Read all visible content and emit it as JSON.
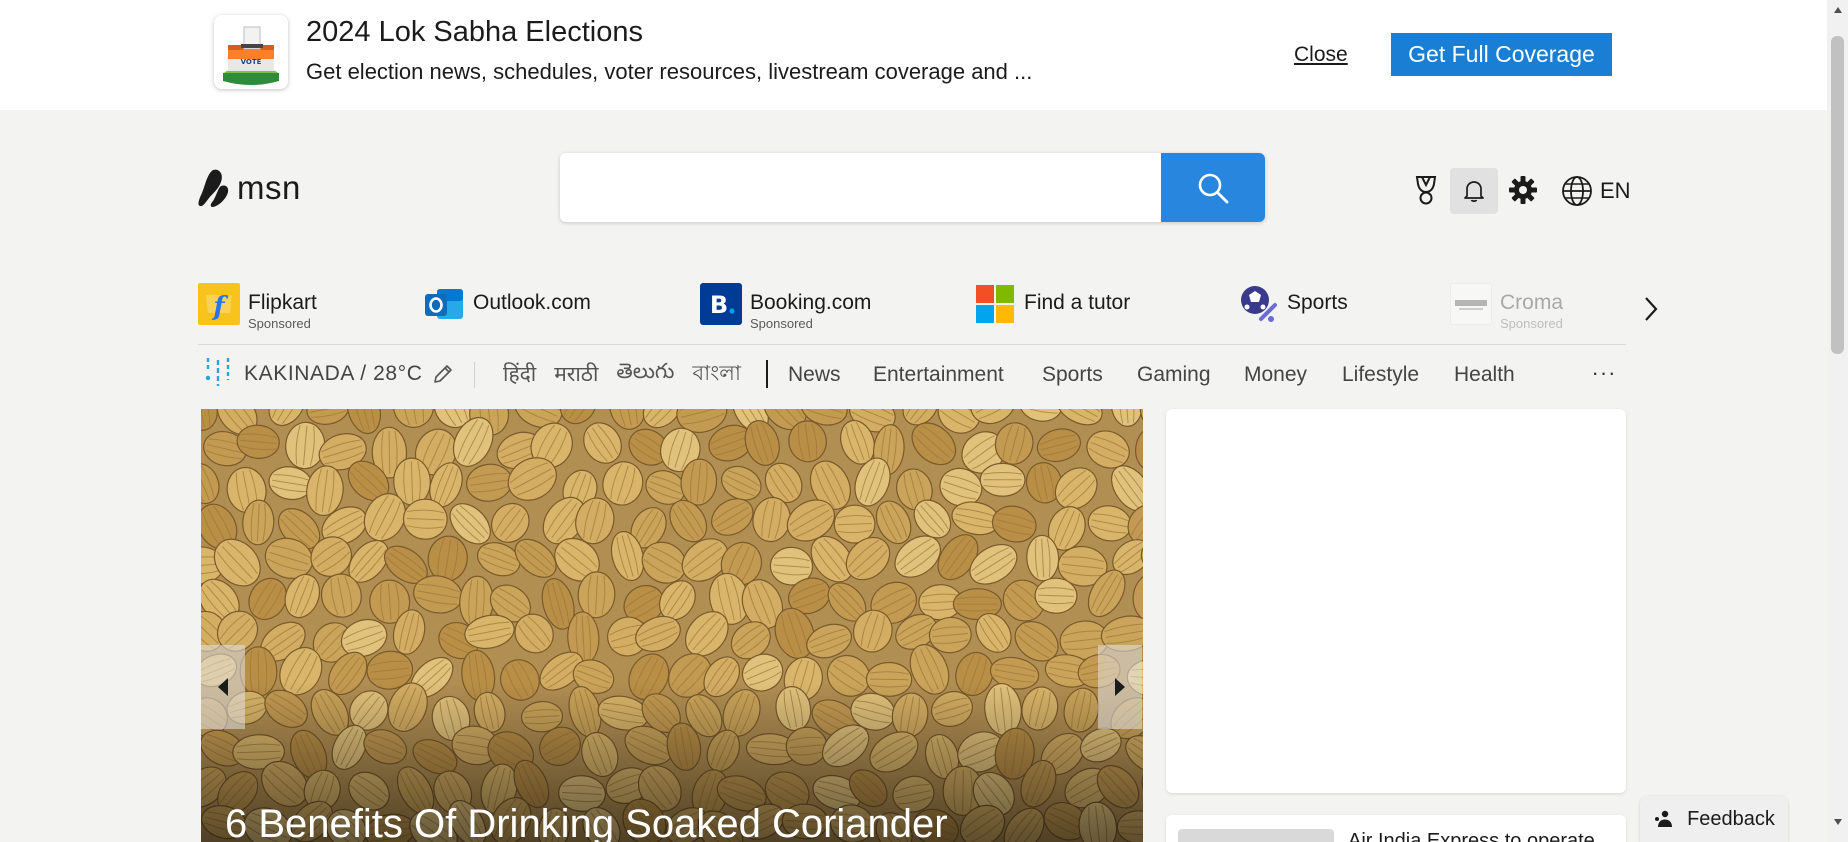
{
  "banner": {
    "title": "2024 Lok Sabha Elections",
    "description": "Get election news, schedules, voter resources, livestream coverage and ...",
    "close_label": "Close",
    "cta_label": "Get Full Coverage",
    "logo_badge_text": "VOTE",
    "icon": "ballot-box-icon"
  },
  "header": {
    "logo_text": "msn",
    "search": {
      "value": "",
      "placeholder": ""
    },
    "icons": [
      "rewards-trophy-icon",
      "bell-icon",
      "gear-icon",
      "globe-icon"
    ],
    "language": "EN"
  },
  "quick_links": [
    {
      "label": "Flipkart",
      "sponsored": "Sponsored",
      "icon": "flipkart-icon",
      "color": "#f8c31c"
    },
    {
      "label": "Outlook.com",
      "sponsored": "",
      "icon": "outlook-icon",
      "color": "#0f6cbd"
    },
    {
      "label": "Booking.com",
      "sponsored": "Sponsored",
      "icon": "booking-icon",
      "color": "#003b95"
    },
    {
      "label": "Find a tutor",
      "sponsored": "",
      "icon": "microsoft-icon",
      "color": "#f25022"
    },
    {
      "label": "Sports",
      "sponsored": "",
      "icon": "sports-icon",
      "color": "#3a3a8c"
    },
    {
      "label": "Croma",
      "sponsored": "Sponsored",
      "icon": "croma-icon",
      "color": "#cfcfcf"
    }
  ],
  "nav": {
    "weather": "KAKINADA / 28°C",
    "languages": [
      "हिंदी",
      "मराठी",
      "తెలుగు",
      "বাংলা"
    ],
    "links": [
      "News",
      "Entertainment",
      "Sports",
      "Gaming",
      "Money",
      "Lifestyle",
      "Health"
    ],
    "more_label": "···"
  },
  "hero": {
    "title": "6 Benefits Of Drinking Soaked Coriander"
  },
  "news": {
    "teaser": "Air India Express to operate..."
  },
  "feedback_label": "Feedback",
  "colors": {
    "accent_blue": "#1a7fd4",
    "search_button": "#2886de",
    "page_background": "#f3f3f2"
  }
}
